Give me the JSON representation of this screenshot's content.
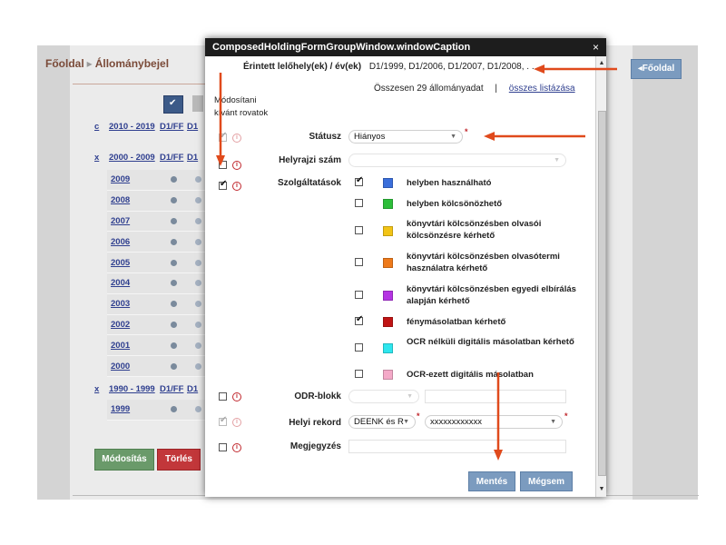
{
  "background": {
    "breadcrumb": [
      "Főoldal",
      "Állománybejel"
    ],
    "home_button": "◂Főoldal",
    "decade_rows": [
      {
        "marker": "c",
        "range": "2010 - 2019",
        "col1": "D1/FF",
        "col2": "D1"
      },
      {
        "marker": "x",
        "range": "2000 - 2009",
        "col1": "D1/FF",
        "col2": "D1"
      },
      {
        "marker": "x",
        "range": "1990 - 1999",
        "col1": "D1/FF",
        "col2": "D1"
      }
    ],
    "years_2000s": [
      "2009",
      "2008",
      "2007",
      "2006",
      "2005",
      "2004",
      "2003",
      "2002",
      "2001",
      "2000"
    ],
    "years_1990s": [
      "1999"
    ],
    "modify_button": "Módosítás",
    "delete_button": "Törlés",
    "colors": {
      "modify": "#6a9a6a",
      "delete": "#c2373a",
      "home": "#7b9bbf"
    }
  },
  "modal": {
    "title": "ComposedHoldingFormGroupWindow.windowCaption",
    "close_icon": "×",
    "affected_label": "Érintett lelőhely(ek) / év(ek)",
    "affected_value": "D1/1999, D1/2006, D1/2007, D1/2008, . . .",
    "total_text": "Összesen 29 állományadat",
    "separator": "|",
    "list_all_link": "összes listázása",
    "modify_header": "Módosítani kívánt rovatok",
    "fields": {
      "status": {
        "label": "Státusz",
        "value": "Hiányos"
      },
      "shelfmark": {
        "label": "Helyrajzi szám",
        "value": ""
      },
      "services": {
        "label": "Szolgáltatások"
      },
      "odr": {
        "label": "ODR-blokk",
        "value": ""
      },
      "local_record": {
        "label": "Helyi rekord",
        "value1": "DEENK és R",
        "value2": "xxxxxxxxxxxx"
      },
      "note": {
        "label": "Megjegyzés",
        "value": ""
      }
    },
    "services_list": [
      {
        "label": "helyben használható",
        "checked": true,
        "color": "#3b6fdb"
      },
      {
        "label": "helyben kölcsönözhető",
        "checked": false,
        "color": "#2dbe3a"
      },
      {
        "label": "könyvtári kölcsönzésben olvasói kölcsönzésre kérhető",
        "checked": false,
        "color": "#f2c416"
      },
      {
        "label": "könyvtári kölcsönzésben olvasótermi használatra kérhető",
        "checked": false,
        "color": "#ee7a1b"
      },
      {
        "label": "könyvtári kölcsönzésben egyedi elbírálás alapján kérhető",
        "checked": false,
        "color": "#b534e3"
      },
      {
        "label": "fénymásolatban kérhető",
        "checked": true,
        "color": "#c01414"
      },
      {
        "label": "OCR nélküli digitális másolatban kérhető",
        "checked": false,
        "color": "#2ee6ee"
      },
      {
        "label": "OCR-ezett digitális másolatban",
        "checked": false,
        "color": "#f4a9c8"
      }
    ],
    "save_button": "Mentés",
    "cancel_button": "Mégsem",
    "required_mark": "*",
    "info_glyph": "i"
  }
}
